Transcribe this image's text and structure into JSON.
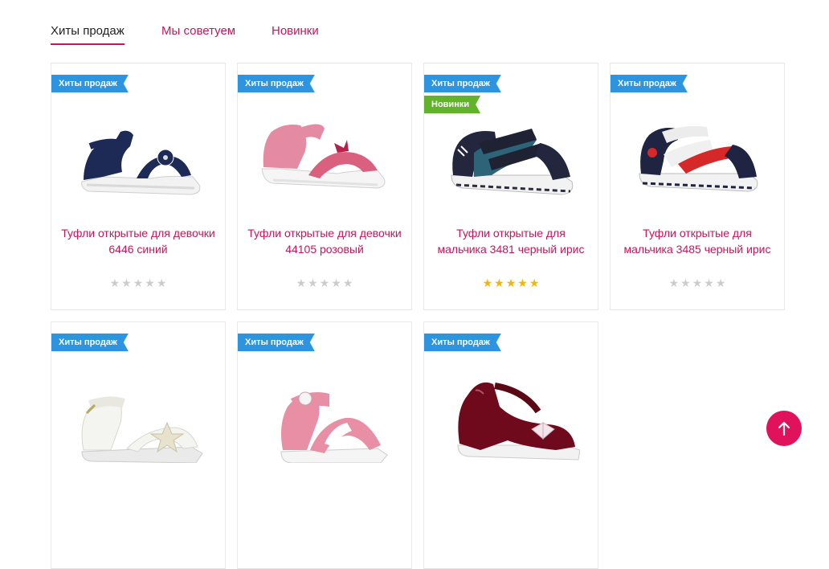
{
  "tabs": [
    {
      "label": "Хиты продаж",
      "active": true
    },
    {
      "label": "Мы советуем",
      "active": false
    },
    {
      "label": "Новинки",
      "active": false
    }
  ],
  "products": [
    {
      "badges": [
        {
          "text": "Хиты продаж",
          "color": "#2d95e0"
        }
      ],
      "title": "Туфли открытые для девочки 6446 синий",
      "rating": 0,
      "image": "navy-girl-sandal"
    },
    {
      "badges": [
        {
          "text": "Хиты продаж",
          "color": "#2d95e0"
        }
      ],
      "title": "Туфли открытые для девочки 44105 розовый",
      "rating": 0,
      "image": "pink-girl-sandal"
    },
    {
      "badges": [
        {
          "text": "Хиты продаж",
          "color": "#2d95e0"
        },
        {
          "text": "Новинки",
          "color": "#62b32c"
        }
      ],
      "title": "Туфли открытые для мальчика 3481 черный ирис",
      "rating": 5,
      "image": "blue-boy-sandal"
    },
    {
      "badges": [
        {
          "text": "Хиты продаж",
          "color": "#2d95e0"
        }
      ],
      "title": "Туфли открытые для мальчика 3485 черный ирис",
      "rating": 0,
      "image": "navy-red-boy-sandal"
    },
    {
      "badges": [
        {
          "text": "Хиты продаж",
          "color": "#2d95e0"
        }
      ],
      "title": "",
      "rating": null,
      "image": "white-girl-sandal"
    },
    {
      "badges": [
        {
          "text": "Хиты продаж",
          "color": "#2d95e0"
        }
      ],
      "title": "",
      "rating": null,
      "image": "pink-white-sandal"
    },
    {
      "badges": [
        {
          "text": "Хиты продаж",
          "color": "#2d95e0"
        }
      ],
      "title": "",
      "rating": null,
      "image": "burgundy-patent-shoe"
    }
  ],
  "scroll_top": {
    "icon": "arrow-up-icon",
    "color": "#e0125b"
  },
  "colors": {
    "accent": "#c2185b",
    "badge_blue": "#2d95e0",
    "badge_green": "#62b32c",
    "star_active": "#f8b400",
    "star_inactive": "#cccccc"
  }
}
